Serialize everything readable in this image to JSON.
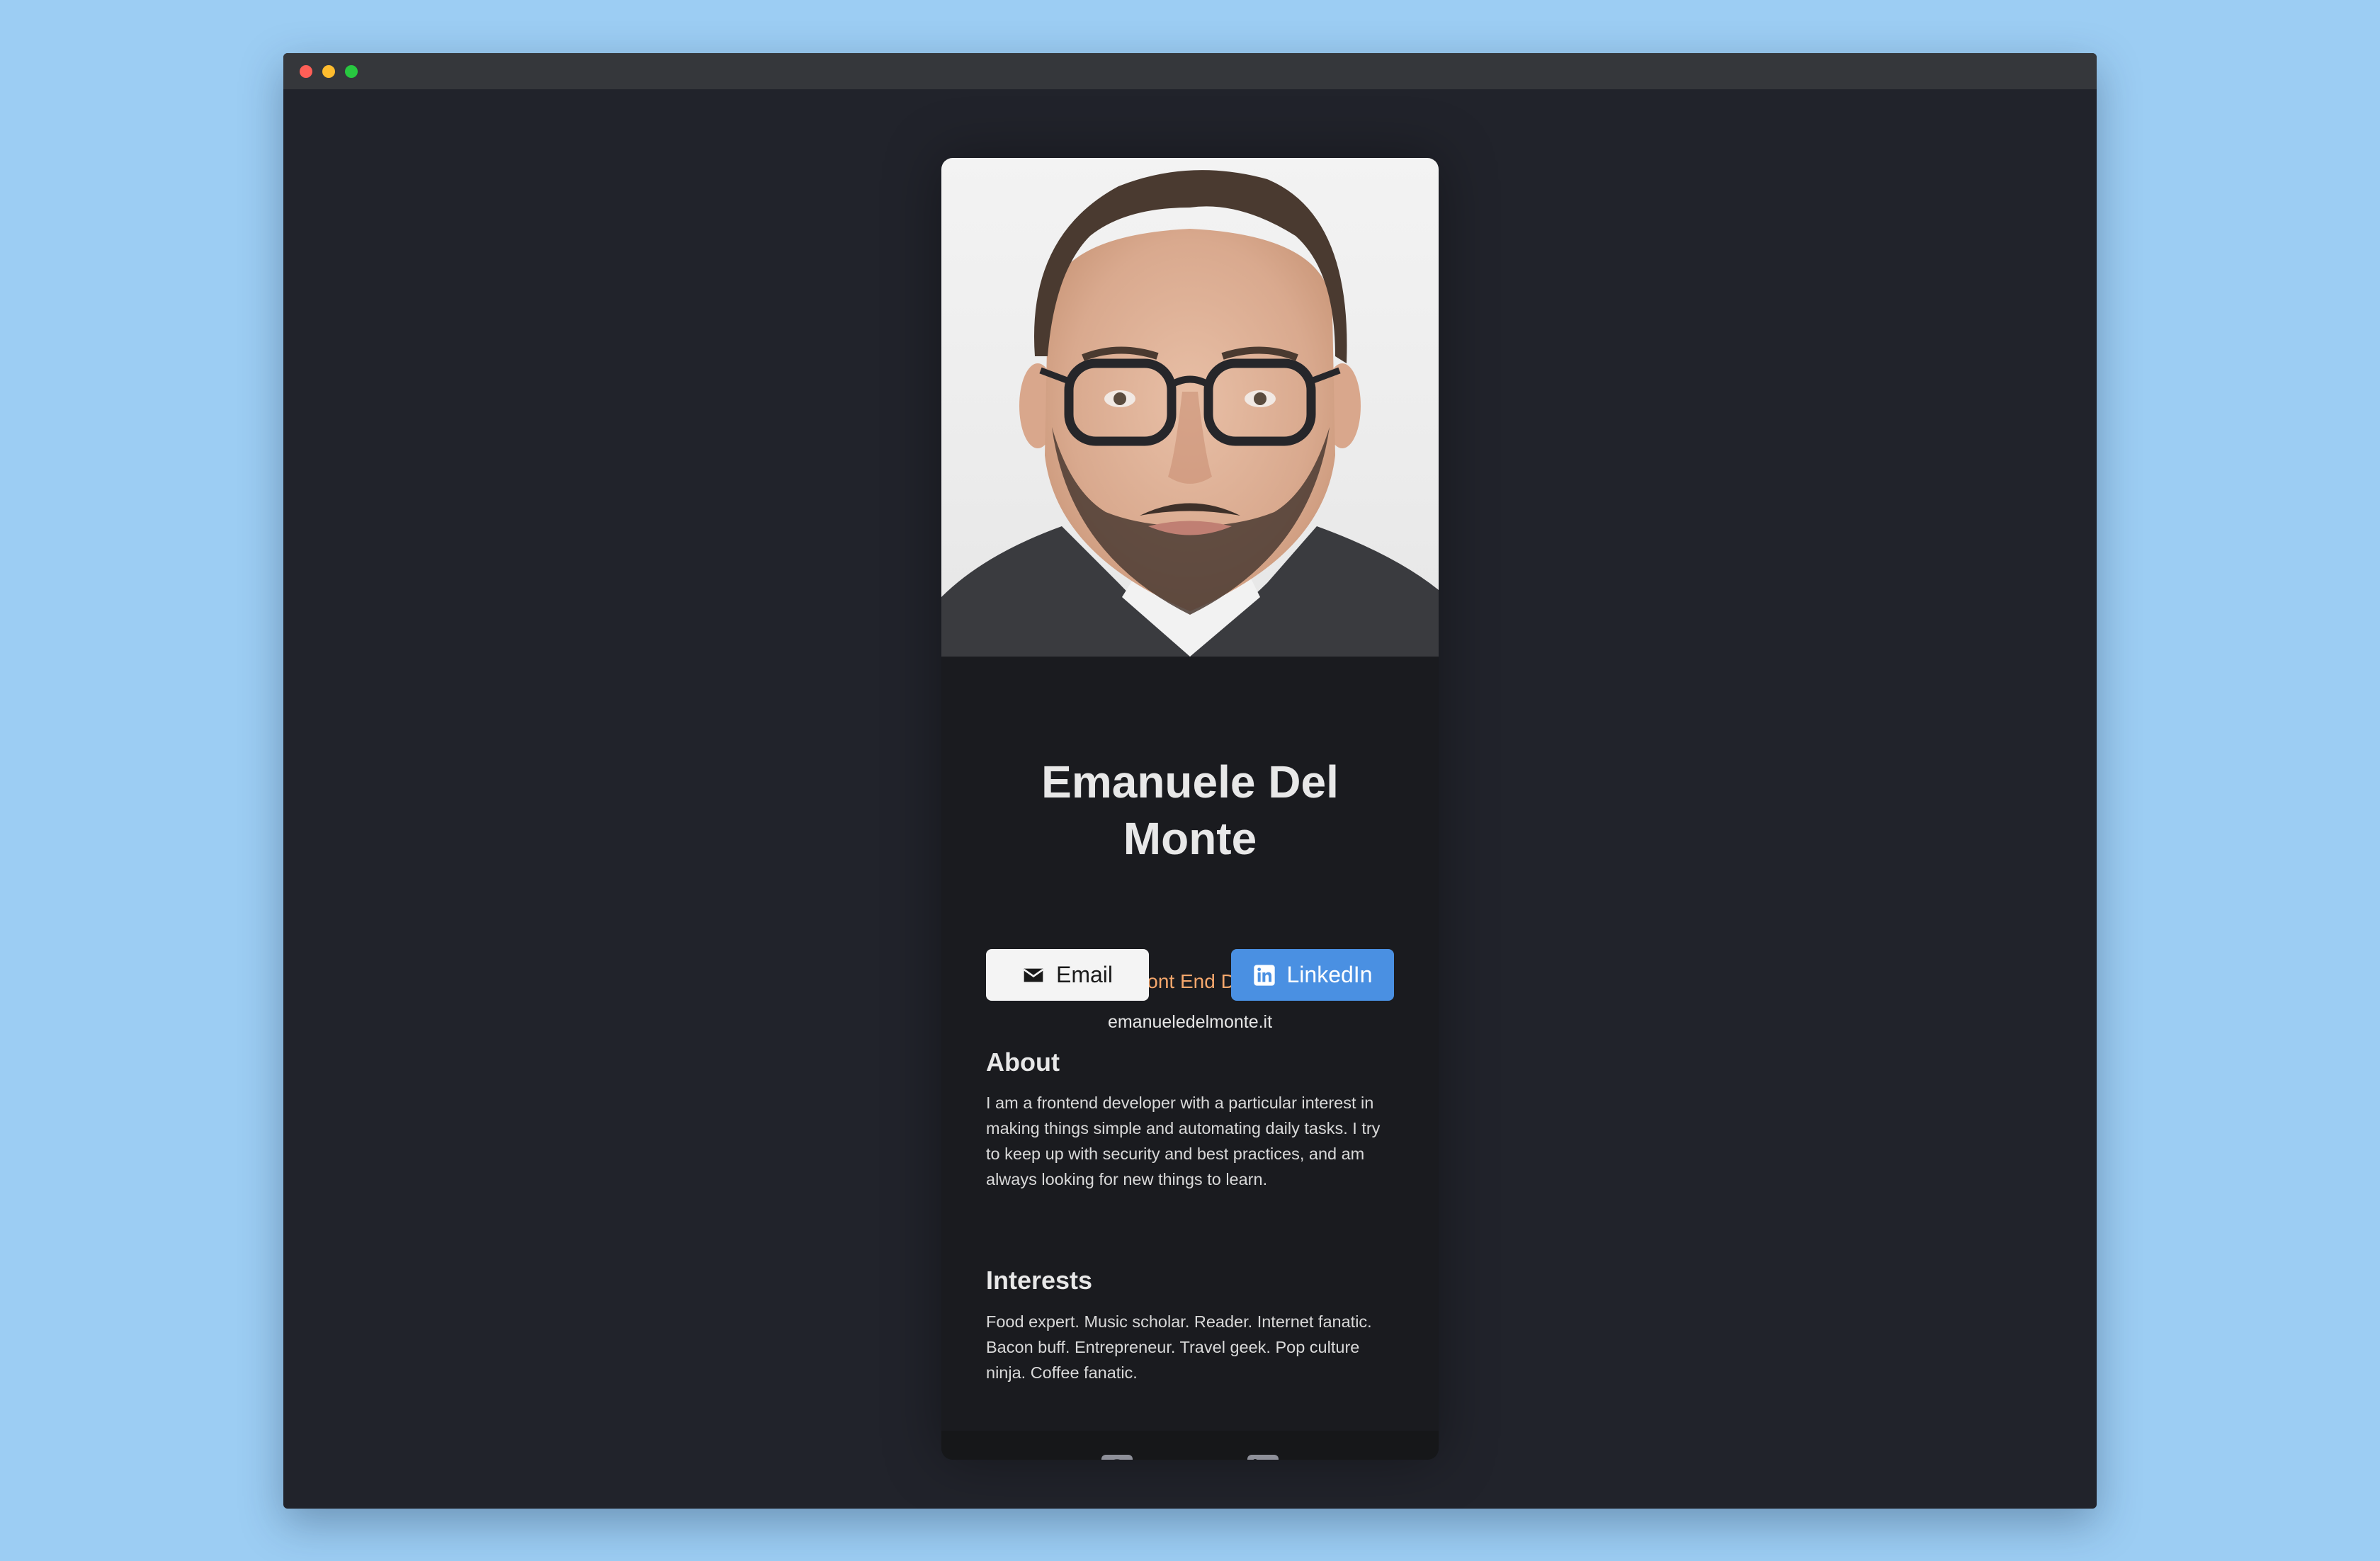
{
  "window": {
    "controls": [
      "close",
      "minimize",
      "maximize"
    ]
  },
  "profile": {
    "photo_alt": "",
    "name": "Emanuele Del Monte",
    "title": "Junior Front End Developer",
    "website": "emanueledelmonte.it"
  },
  "buttons": {
    "email_label": "Email",
    "linkedin_label": "LinkedIn"
  },
  "about": {
    "heading": "About",
    "text": "I am a frontend developer with a particular interest in making things simple and automating daily tasks. I try to keep up with security and best practices, and am always looking for new things to learn."
  },
  "interests": {
    "heading": "Interests",
    "text": "Food expert. Music scholar. Reader. Internet fanatic. Bacon buff. Entrepreneur. Travel geek. Pop culture ninja. Coffee fanatic."
  },
  "footer": {
    "icons": [
      "github-icon",
      "linkedin-icon"
    ]
  },
  "colors": {
    "page_background": "#9ccdf3",
    "window_background": "#21232b",
    "card_background": "#1a1b1f",
    "footer_background": "#161719",
    "accent_orange": "#f5a76c",
    "linkedin_blue": "#4a90e2"
  }
}
